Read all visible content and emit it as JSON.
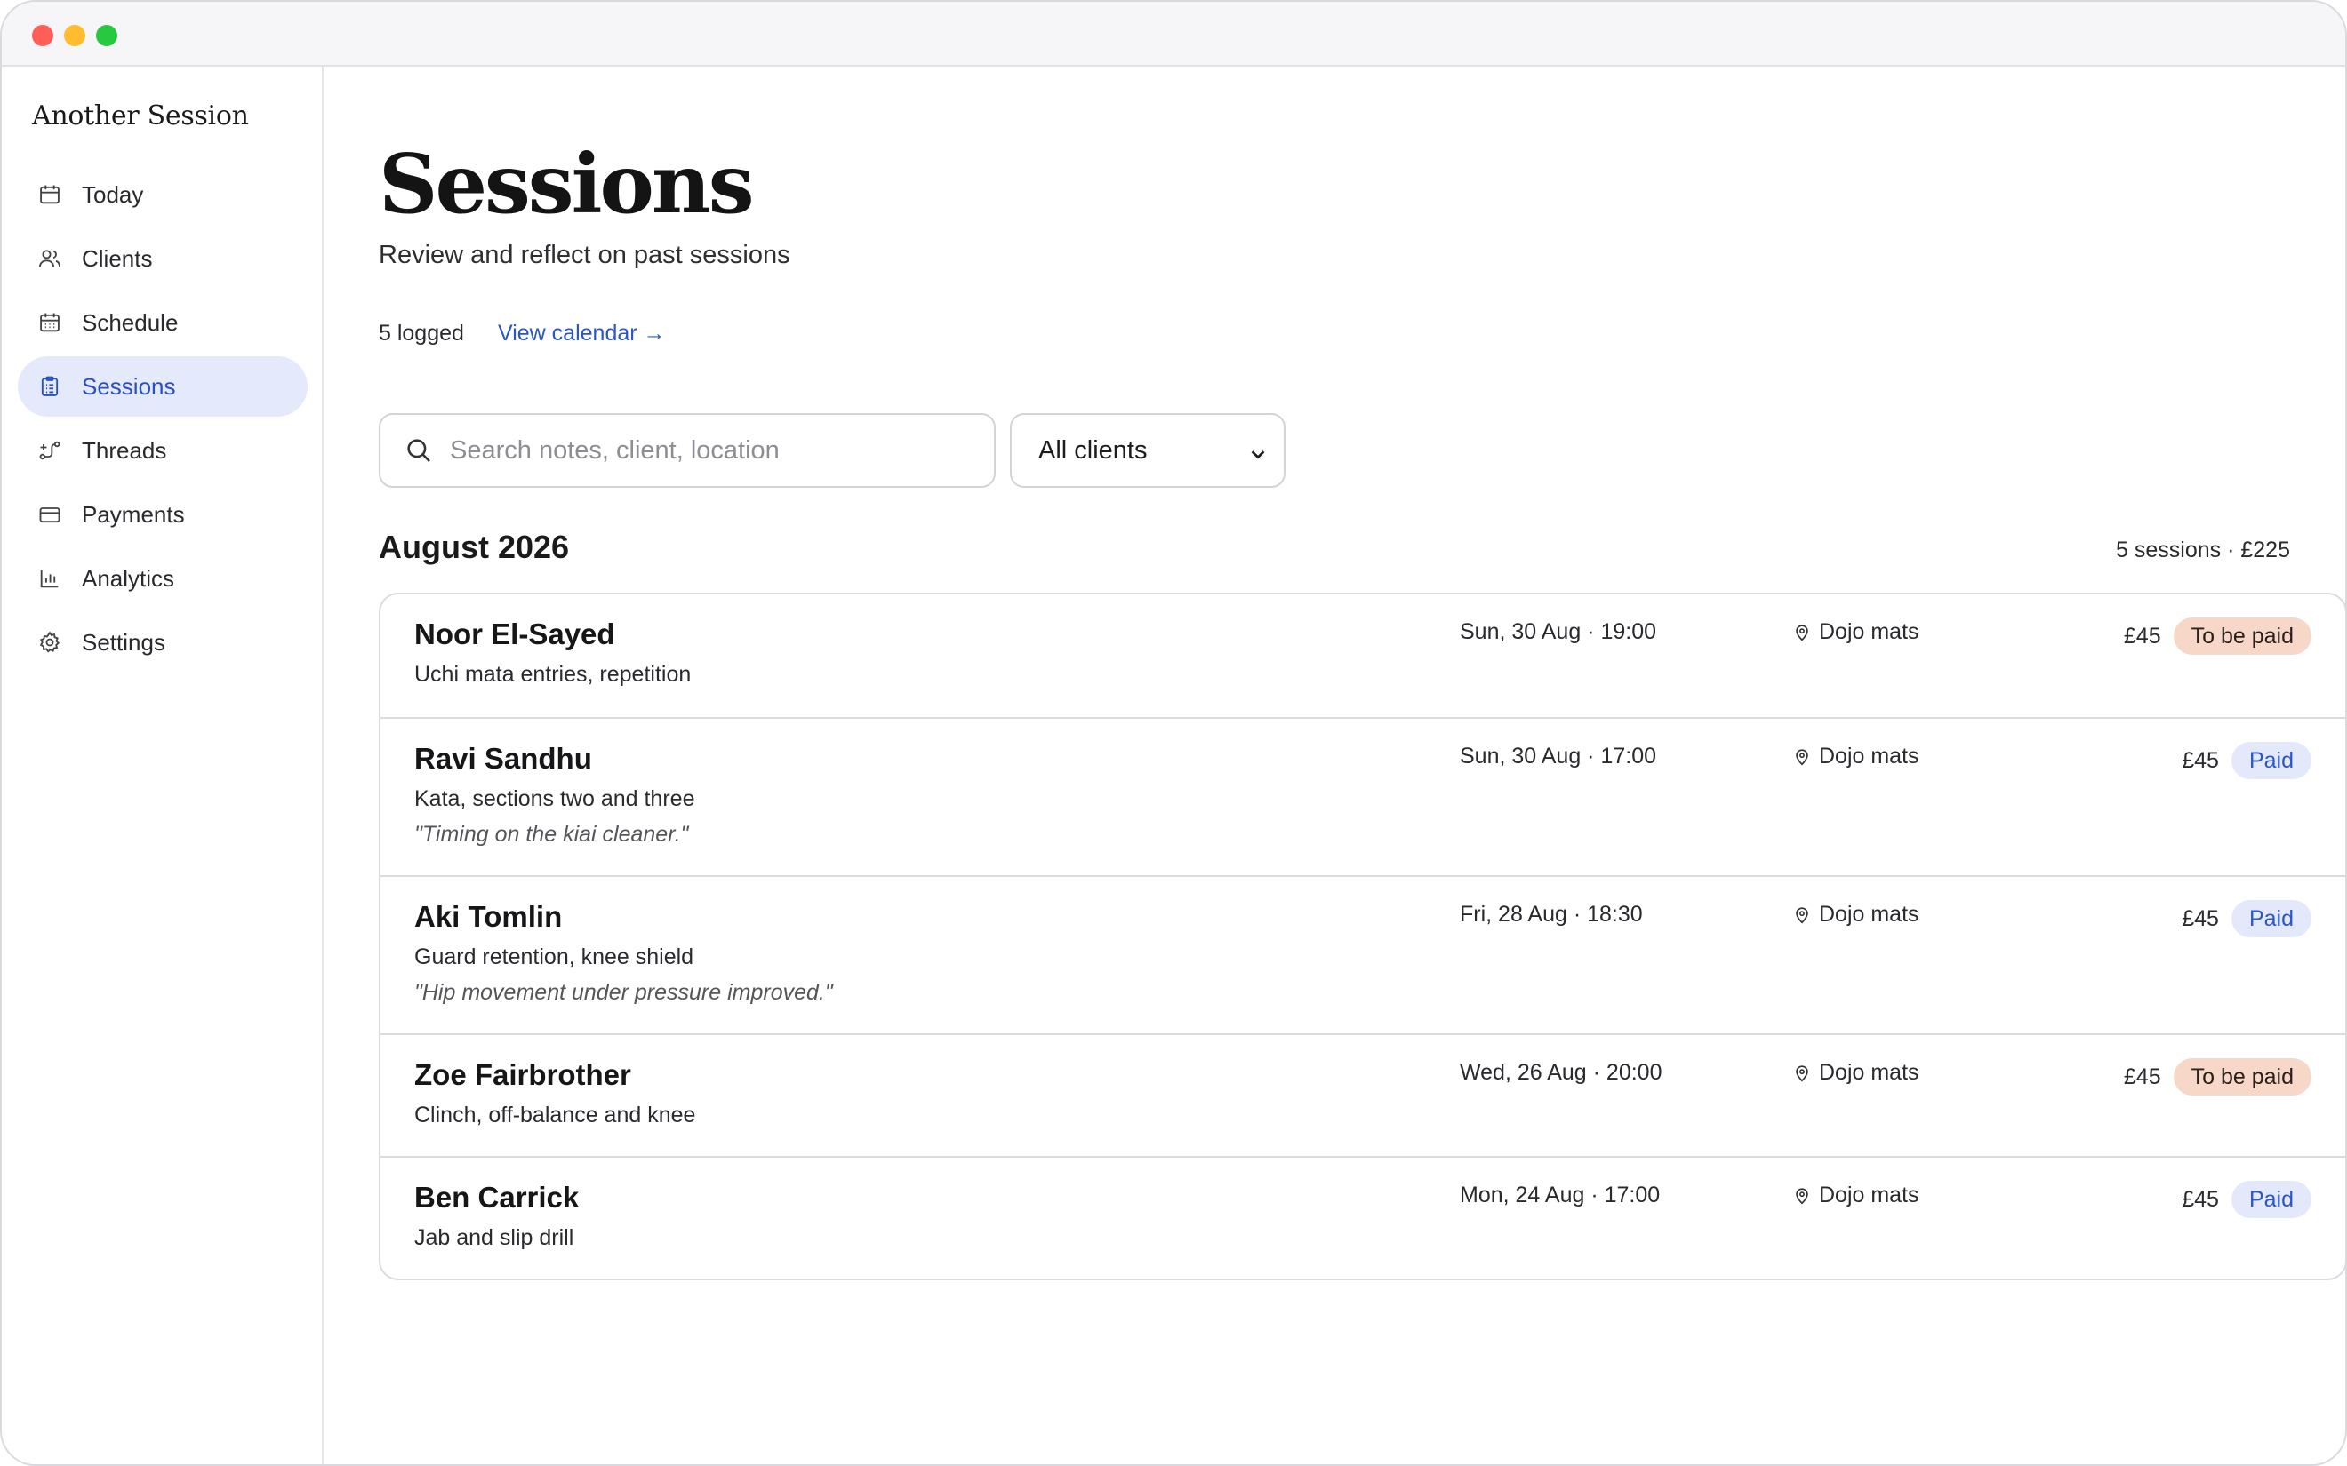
{
  "app": {
    "brand": "Another Session"
  },
  "sidebar": {
    "items": [
      {
        "label": "Today",
        "icon": "calendar-icon",
        "active": false
      },
      {
        "label": "Clients",
        "icon": "users-icon",
        "active": false
      },
      {
        "label": "Schedule",
        "icon": "calendar-grid-icon",
        "active": false
      },
      {
        "label": "Sessions",
        "icon": "clipboard-icon",
        "active": true
      },
      {
        "label": "Threads",
        "icon": "threads-icon",
        "active": false
      },
      {
        "label": "Payments",
        "icon": "credit-card-icon",
        "active": false
      },
      {
        "label": "Analytics",
        "icon": "bar-chart-icon",
        "active": false
      },
      {
        "label": "Settings",
        "icon": "gear-icon",
        "active": false
      }
    ]
  },
  "header": {
    "title": "Sessions",
    "subtitle": "Review and reflect on past sessions",
    "logged_count": "5 logged",
    "view_calendar": "View calendar →"
  },
  "filters": {
    "search_placeholder": "Search notes, client, location",
    "client_select": "All clients"
  },
  "group": {
    "month": "August 2026",
    "summary": "5 sessions · £225"
  },
  "sessions": [
    {
      "client": "Noor El-Sayed",
      "topic": "Uchi mata entries, repetition",
      "note": "",
      "when": "Sun, 30 Aug · 19:00",
      "location": "Dojo mats",
      "amount": "£45",
      "status": "To be paid"
    },
    {
      "client": "Ravi Sandhu",
      "topic": "Kata, sections two and three",
      "note": "\"Timing on the kiai cleaner.\"",
      "when": "Sun, 30 Aug · 17:00",
      "location": "Dojo mats",
      "amount": "£45",
      "status": "Paid"
    },
    {
      "client": "Aki Tomlin",
      "topic": "Guard retention, knee shield",
      "note": "\"Hip movement under pressure improved.\"",
      "when": "Fri, 28 Aug · 18:30",
      "location": "Dojo mats",
      "amount": "£45",
      "status": "Paid"
    },
    {
      "client": "Zoe Fairbrother",
      "topic": "Clinch, off-balance and knee",
      "note": "",
      "when": "Wed, 26 Aug · 20:00",
      "location": "Dojo mats",
      "amount": "£45",
      "status": "To be paid"
    },
    {
      "client": "Ben Carrick",
      "topic": "Jab and slip drill",
      "note": "",
      "when": "Mon, 24 Aug · 17:00",
      "location": "Dojo mats",
      "amount": "£45",
      "status": "Paid"
    }
  ],
  "colors": {
    "accent": "#2a56c6",
    "active_nav_bg": "#e4e9fc",
    "due_badge_bg": "#f7d8c8",
    "paid_badge_bg": "#e3e8fb"
  }
}
